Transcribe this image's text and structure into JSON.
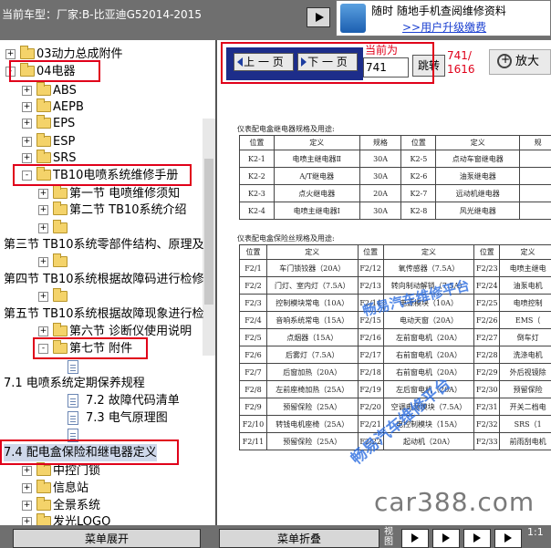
{
  "header": {
    "car_model_text": "当前车型：厂家:B-比亚迪G52014-2015",
    "promo_line1": "随时 随地手机查阅维修资料",
    "promo_line2": ">>用户升级缴费"
  },
  "tree": {
    "items": [
      {
        "label": "03动力总成附件",
        "expander": "+",
        "icon": "folder"
      },
      {
        "label": "04电器",
        "expander": "-",
        "icon": "folder"
      },
      {
        "label": "ABS",
        "expander": "+",
        "icon": "folder"
      },
      {
        "label": "AEPB",
        "expander": "+",
        "icon": "folder"
      },
      {
        "label": "EPS",
        "expander": "+",
        "icon": "folder"
      },
      {
        "label": "ESP",
        "expander": "+",
        "icon": "folder"
      },
      {
        "label": "SRS",
        "expander": "+",
        "icon": "folder"
      },
      {
        "label": "TB10电喷系统维修手册",
        "expander": "-",
        "icon": "folder"
      },
      {
        "label": "第一节 电喷维修须知",
        "expander": "+",
        "icon": "folder"
      },
      {
        "label": "第二节 TB10系统介绍",
        "expander": "+",
        "icon": "folder"
      },
      {
        "label": "",
        "expander": "+",
        "icon": "folder"
      },
      {
        "label": "第三节 TB10系统零部件结构、原理及",
        "expander": "",
        "icon": "none"
      },
      {
        "label": "",
        "expander": "+",
        "icon": "folder"
      },
      {
        "label": "第四节 TB10系统根据故障码进行检修",
        "expander": "",
        "icon": "none"
      },
      {
        "label": "",
        "expander": "+",
        "icon": "folder"
      },
      {
        "label": "第五节 TB10系统根据故障现象进行检",
        "expander": "",
        "icon": "none"
      },
      {
        "label": "第六节 诊断仪使用说明",
        "expander": "+",
        "icon": "folder"
      },
      {
        "label": "第七节 附件",
        "expander": "-",
        "icon": "folder"
      },
      {
        "label": "",
        "expander": "",
        "icon": "doc"
      },
      {
        "label": "7.1 电喷系统定期保养规程",
        "expander": "",
        "icon": "none"
      },
      {
        "label": "7.2 故障代码清单",
        "expander": "",
        "icon": "doc"
      },
      {
        "label": "7.3 电气原理图",
        "expander": "",
        "icon": "doc"
      },
      {
        "label": "",
        "expander": "",
        "icon": "doc"
      },
      {
        "label": "7.4 配电盒保险和继电器定义",
        "expander": "",
        "icon": "none"
      },
      {
        "label": "中控门锁",
        "expander": "+",
        "icon": "folder"
      },
      {
        "label": "信息站",
        "expander": "+",
        "icon": "folder"
      },
      {
        "label": "全景系统",
        "expander": "+",
        "icon": "folder"
      },
      {
        "label": "发光LOGO",
        "expander": "+",
        "icon": "folder"
      }
    ]
  },
  "nav": {
    "prev_label": "上 一 页",
    "next_label": "下 一 页",
    "current_label": "当前为",
    "page_value": "741",
    "jump_label": "跳转",
    "page_fraction_1": "741/",
    "page_fraction_2": "1616",
    "zoom_label": "放大"
  },
  "sheet": {
    "relay_title": "仪表配电盒继电器规格及用途:",
    "relay_headers": [
      "位置",
      "定义",
      "规格",
      "位置",
      "定义",
      "规"
    ],
    "relay_rows": [
      [
        "K2-1",
        "电喷主继电器Ⅱ",
        "30A",
        "K2-5",
        "点动车窗继电器",
        ""
      ],
      [
        "K2-2",
        "A/T继电器",
        "30A",
        "K2-6",
        "油泵继电器",
        ""
      ],
      [
        "K2-3",
        "点火继电器",
        "20A",
        "K2-7",
        "远动机继电器",
        ""
      ],
      [
        "K2-4",
        "电喷主继电器Ⅰ",
        "30A",
        "K2-8",
        "风光继电器",
        ""
      ]
    ],
    "fuse_title": "仪表配电盒保险丝规格及用途:",
    "fuse_headers": [
      "位置",
      "定义",
      "位置",
      "定义",
      "位置",
      "定义"
    ],
    "fuse_rows": [
      [
        "F2/1",
        "车门锁铰器（20A）",
        "F2/12",
        "氧传感器（7.5A）",
        "F2/23",
        "电喷主继电"
      ],
      [
        "F2/2",
        "门灯、室内灯（7.5A）",
        "F2/13",
        "转向制动解锁（7.5A）",
        "F2/24",
        "油泵电机"
      ],
      [
        "F2/3",
        "控制模块常电（10A）",
        "F2/14",
        "电源模块（10A）",
        "F2/25",
        "电喷控制"
      ],
      [
        "F2/4",
        "音响系统常电（15A）",
        "F2/15",
        "电动天窗（20A）",
        "F2/26",
        "EMS（"
      ],
      [
        "F2/5",
        "点烟器（15A）",
        "F2/16",
        "左前窗电机（20A）",
        "F2/27",
        "倒车灯"
      ],
      [
        "F2/6",
        "后雾灯（7.5A）",
        "F2/17",
        "右前窗电机（20A）",
        "F2/28",
        "洗涤电机"
      ],
      [
        "F2/7",
        "后窗加热（20A）",
        "F2/18",
        "右前窗电机（20A）",
        "F2/29",
        "外后视镜除"
      ],
      [
        "F2/8",
        "左前座椅加热（25A）",
        "F2/19",
        "左后窗电机（20A）",
        "F2/30",
        "预留保险"
      ],
      [
        "F2/9",
        "预留保险（25A）",
        "F2/20",
        "空调电源模块（7.5A）",
        "F2/31",
        "开关二档电"
      ],
      [
        "F2/10",
        "转钱电机座椅（25A）",
        "F2/21",
        "电控制模块（15A）",
        "F2/32",
        "SRS（1"
      ],
      [
        "F2/11",
        "预留保险（25A）",
        "F2/22",
        "起动机（20A）",
        "F2/33",
        "前雨刮电机"
      ]
    ],
    "watermark_1": "畅易汽车维修平台",
    "watermark_2": "畅易汽车维修平台"
  },
  "brand_watermark": "car388.com",
  "footer": {
    "expand_label": "菜单展开",
    "collapse_label": "菜单折叠",
    "view_label": "视图",
    "page_indicator": "1:1"
  },
  "colors": {
    "accent_red": "#e0001a",
    "nav_blue": "#1d2d8a",
    "bar_gray": "#6f6f6f"
  }
}
